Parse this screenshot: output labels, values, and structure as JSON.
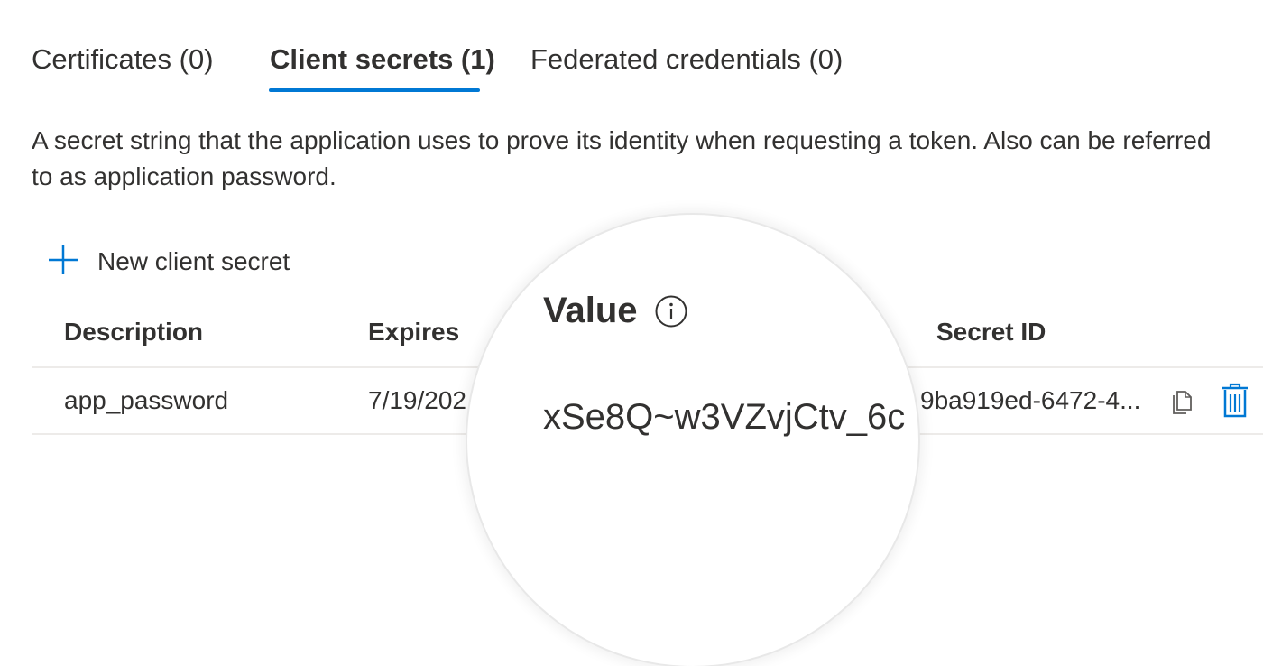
{
  "tabs": [
    {
      "label": "Certificates (0)",
      "active": false
    },
    {
      "label": "Client secrets (1)",
      "active": true
    },
    {
      "label": "Federated credentials (0)",
      "active": false
    }
  ],
  "description": "A secret string that the application uses to prove its identity when requesting a token. Also can be referred to as application password.",
  "toolbar": {
    "new_secret_label": "New client secret",
    "icon": "plus-icon"
  },
  "table": {
    "columns": {
      "description": "Description",
      "expires": "Expires",
      "value": "Value",
      "secret_id": "Secret ID"
    },
    "rows": [
      {
        "description": "app_password",
        "expires": "7/19/202",
        "value": "xSe8Q~w3VZvjCtv_6c",
        "secret_id": "9ba919ed-6472-4..."
      }
    ]
  },
  "icons": {
    "info": "info-icon",
    "copy": "copy-icon",
    "delete": "trash-icon"
  },
  "colors": {
    "accent": "#0078d4",
    "text": "#323130",
    "divider": "#edebe9"
  }
}
